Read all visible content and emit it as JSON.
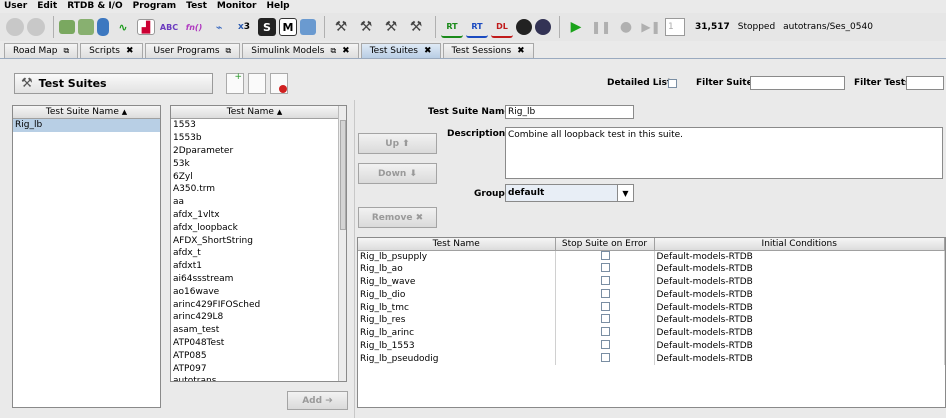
{
  "menu": [
    "User",
    "Edit",
    "RTDB & I/O",
    "Program",
    "Test",
    "Monitor",
    "Help"
  ],
  "toolbar": {
    "icons": [
      "stop-circle-icon",
      "stop-circle-icon",
      "image-icon",
      "check-image-icon",
      "database-icon",
      "wave-icon",
      "chart-icon",
      "abc-icon",
      "fn-icon",
      "graph-icon",
      "variable-icon",
      "s-icon",
      "m-icon",
      "tree-icon",
      "hammer-icon",
      "build-icon",
      "build-ac-icon",
      "tools-icon",
      "rt-icon",
      "rt2-icon",
      "dl-icon",
      "gauge-icon",
      "timer-icon",
      "play-icon",
      "pause-icon",
      "record-icon",
      "step-icon"
    ],
    "x3_label": "3",
    "s_label": "S",
    "m_label": "M",
    "rt_label": "RT",
    "dl_label": "DL",
    "abc_label": "ABC",
    "fn_label": "fn()",
    "step_value": "1",
    "counter": "31,517",
    "status": "Stopped",
    "path": "autotrans/Ses_0540"
  },
  "tabs": [
    {
      "label": "Road Map",
      "icon": "window"
    },
    {
      "label": "Scripts",
      "icon": "close"
    },
    {
      "label": "User Programs",
      "icon": "window"
    },
    {
      "label": "Simulink Models",
      "icon": "both"
    },
    {
      "label": "Test Suites",
      "icon": "close",
      "active": true
    },
    {
      "label": "Test Sessions",
      "icon": "close"
    }
  ],
  "header": {
    "title": "Test Suites",
    "detailed_label": "Detailed List:",
    "filter_suites_label": "Filter Suites:",
    "filter_tests_label": "Filter Tests:"
  },
  "suites": {
    "col": "Test Suite Name",
    "sort": "▲",
    "items": [
      "Rig_lb"
    ]
  },
  "tests": {
    "col": "Test Name",
    "sort": "▲",
    "items": [
      "1553",
      "1553b",
      "2Dparameter",
      "53k",
      "6Zyl",
      "A350.trm",
      "aa",
      "afdx_1vltx",
      "afdx_loopback",
      "AFDX_ShortString",
      "afdx_t",
      "afdxt1",
      "ai64ssstream",
      "ao16wave",
      "arinc429FIFOSched",
      "arinc429L8",
      "asam_test",
      "ATP048Test",
      "ATP085",
      "ATP097",
      "autotrans"
    ]
  },
  "buttons": {
    "add": "Add",
    "up": "Up",
    "down": "Down",
    "remove": "Remove",
    "arrow_right": "➔",
    "arrow_up": "⬆",
    "arrow_down": "⬇",
    "x_mark": "✖"
  },
  "detail": {
    "name_label": "Test Suite Name:",
    "name_value": "Rig_lb",
    "desc_label": "Description:",
    "desc_value": "Combine all loopback test in this suite.",
    "group_label": "Group:",
    "group_value": "default"
  },
  "grid": {
    "cols": [
      "Test Name",
      "Stop Suite on Error",
      "Initial Conditions"
    ],
    "rows": [
      [
        "Rig_lb_psupply",
        "Default-models-RTDB"
      ],
      [
        "Rig_lb_ao",
        "Default-models-RTDB"
      ],
      [
        "Rig_lb_wave",
        "Default-models-RTDB"
      ],
      [
        "Rig_lb_dio",
        "Default-models-RTDB"
      ],
      [
        "Rig_lb_tmc",
        "Default-models-RTDB"
      ],
      [
        "Rig_lb_res",
        "Default-models-RTDB"
      ],
      [
        "Rig_lb_arinc",
        "Default-models-RTDB"
      ],
      [
        "Rig_lb_1553",
        "Default-models-RTDB"
      ],
      [
        "Rig_lb_pseudodig",
        "Default-models-RTDB"
      ]
    ]
  },
  "colors": {
    "accent": "#b8cfe5",
    "play": "#1aa31a"
  }
}
